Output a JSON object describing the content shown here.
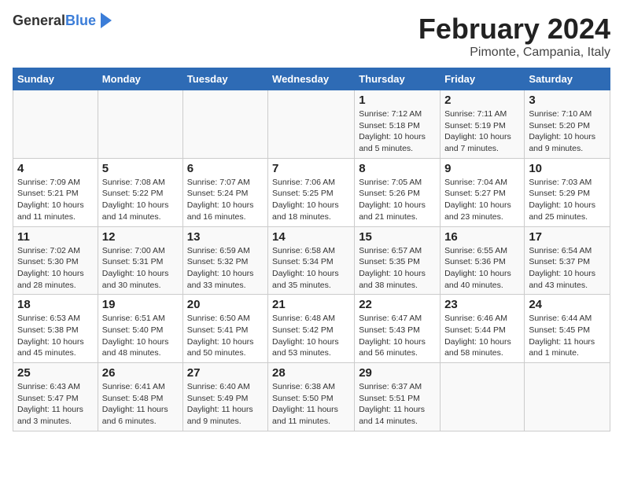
{
  "header": {
    "logo_general": "General",
    "logo_blue": "Blue",
    "title": "February 2024",
    "subtitle": "Pimonte, Campania, Italy"
  },
  "days_of_week": [
    "Sunday",
    "Monday",
    "Tuesday",
    "Wednesday",
    "Thursday",
    "Friday",
    "Saturday"
  ],
  "weeks": [
    [
      {
        "num": "",
        "detail": ""
      },
      {
        "num": "",
        "detail": ""
      },
      {
        "num": "",
        "detail": ""
      },
      {
        "num": "",
        "detail": ""
      },
      {
        "num": "1",
        "detail": "Sunrise: 7:12 AM\nSunset: 5:18 PM\nDaylight: 10 hours\nand 5 minutes."
      },
      {
        "num": "2",
        "detail": "Sunrise: 7:11 AM\nSunset: 5:19 PM\nDaylight: 10 hours\nand 7 minutes."
      },
      {
        "num": "3",
        "detail": "Sunrise: 7:10 AM\nSunset: 5:20 PM\nDaylight: 10 hours\nand 9 minutes."
      }
    ],
    [
      {
        "num": "4",
        "detail": "Sunrise: 7:09 AM\nSunset: 5:21 PM\nDaylight: 10 hours\nand 11 minutes."
      },
      {
        "num": "5",
        "detail": "Sunrise: 7:08 AM\nSunset: 5:22 PM\nDaylight: 10 hours\nand 14 minutes."
      },
      {
        "num": "6",
        "detail": "Sunrise: 7:07 AM\nSunset: 5:24 PM\nDaylight: 10 hours\nand 16 minutes."
      },
      {
        "num": "7",
        "detail": "Sunrise: 7:06 AM\nSunset: 5:25 PM\nDaylight: 10 hours\nand 18 minutes."
      },
      {
        "num": "8",
        "detail": "Sunrise: 7:05 AM\nSunset: 5:26 PM\nDaylight: 10 hours\nand 21 minutes."
      },
      {
        "num": "9",
        "detail": "Sunrise: 7:04 AM\nSunset: 5:27 PM\nDaylight: 10 hours\nand 23 minutes."
      },
      {
        "num": "10",
        "detail": "Sunrise: 7:03 AM\nSunset: 5:29 PM\nDaylight: 10 hours\nand 25 minutes."
      }
    ],
    [
      {
        "num": "11",
        "detail": "Sunrise: 7:02 AM\nSunset: 5:30 PM\nDaylight: 10 hours\nand 28 minutes."
      },
      {
        "num": "12",
        "detail": "Sunrise: 7:00 AM\nSunset: 5:31 PM\nDaylight: 10 hours\nand 30 minutes."
      },
      {
        "num": "13",
        "detail": "Sunrise: 6:59 AM\nSunset: 5:32 PM\nDaylight: 10 hours\nand 33 minutes."
      },
      {
        "num": "14",
        "detail": "Sunrise: 6:58 AM\nSunset: 5:34 PM\nDaylight: 10 hours\nand 35 minutes."
      },
      {
        "num": "15",
        "detail": "Sunrise: 6:57 AM\nSunset: 5:35 PM\nDaylight: 10 hours\nand 38 minutes."
      },
      {
        "num": "16",
        "detail": "Sunrise: 6:55 AM\nSunset: 5:36 PM\nDaylight: 10 hours\nand 40 minutes."
      },
      {
        "num": "17",
        "detail": "Sunrise: 6:54 AM\nSunset: 5:37 PM\nDaylight: 10 hours\nand 43 minutes."
      }
    ],
    [
      {
        "num": "18",
        "detail": "Sunrise: 6:53 AM\nSunset: 5:38 PM\nDaylight: 10 hours\nand 45 minutes."
      },
      {
        "num": "19",
        "detail": "Sunrise: 6:51 AM\nSunset: 5:40 PM\nDaylight: 10 hours\nand 48 minutes."
      },
      {
        "num": "20",
        "detail": "Sunrise: 6:50 AM\nSunset: 5:41 PM\nDaylight: 10 hours\nand 50 minutes."
      },
      {
        "num": "21",
        "detail": "Sunrise: 6:48 AM\nSunset: 5:42 PM\nDaylight: 10 hours\nand 53 minutes."
      },
      {
        "num": "22",
        "detail": "Sunrise: 6:47 AM\nSunset: 5:43 PM\nDaylight: 10 hours\nand 56 minutes."
      },
      {
        "num": "23",
        "detail": "Sunrise: 6:46 AM\nSunset: 5:44 PM\nDaylight: 10 hours\nand 58 minutes."
      },
      {
        "num": "24",
        "detail": "Sunrise: 6:44 AM\nSunset: 5:45 PM\nDaylight: 11 hours\nand 1 minute."
      }
    ],
    [
      {
        "num": "25",
        "detail": "Sunrise: 6:43 AM\nSunset: 5:47 PM\nDaylight: 11 hours\nand 3 minutes."
      },
      {
        "num": "26",
        "detail": "Sunrise: 6:41 AM\nSunset: 5:48 PM\nDaylight: 11 hours\nand 6 minutes."
      },
      {
        "num": "27",
        "detail": "Sunrise: 6:40 AM\nSunset: 5:49 PM\nDaylight: 11 hours\nand 9 minutes."
      },
      {
        "num": "28",
        "detail": "Sunrise: 6:38 AM\nSunset: 5:50 PM\nDaylight: 11 hours\nand 11 minutes."
      },
      {
        "num": "29",
        "detail": "Sunrise: 6:37 AM\nSunset: 5:51 PM\nDaylight: 11 hours\nand 14 minutes."
      },
      {
        "num": "",
        "detail": ""
      },
      {
        "num": "",
        "detail": ""
      }
    ]
  ]
}
